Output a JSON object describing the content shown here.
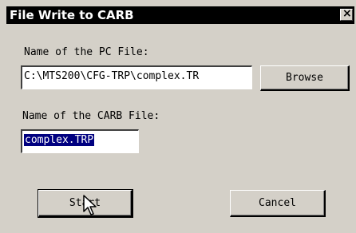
{
  "dialog": {
    "title": "File Write to CARB",
    "close_glyph": "×"
  },
  "pc_file": {
    "label": "Name of the PC File:",
    "value": "C:\\MTS200\\CFG-TRP\\complex.TR"
  },
  "browse_button": {
    "label": "Browse"
  },
  "carb_file": {
    "label": "Name of the CARB File:",
    "value": "complex.TRP"
  },
  "start_button": {
    "label": "Start"
  },
  "cancel_button": {
    "label": "Cancel"
  },
  "cursor_icon": "arrow-pointer"
}
